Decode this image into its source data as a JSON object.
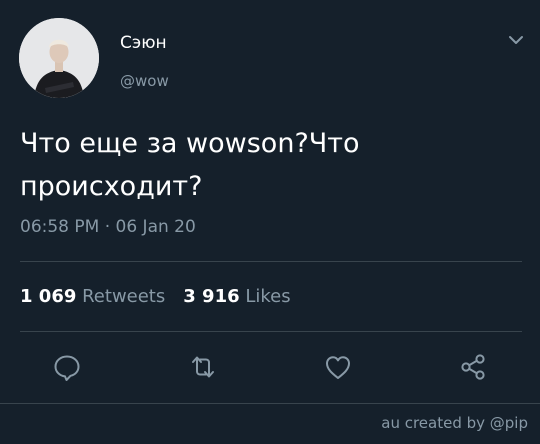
{
  "author": {
    "name": "Сэюн",
    "handle": "@wow"
  },
  "tweet": {
    "text_line1": "Что еще за wowson?Что",
    "text_line2": "происходит?",
    "timestamp": "06:58 PM · 06 Jan 20"
  },
  "stats": {
    "retweets_count": "1 069",
    "retweets_label": "Retweets",
    "likes_count": "3 916",
    "likes_label": "Likes"
  },
  "actions": [
    "reply-icon",
    "retweet-icon",
    "like-icon",
    "share-icon"
  ],
  "footer": {
    "credit": "au created by @pip"
  },
  "colors": {
    "background": "#15202b",
    "text": "#ffffff",
    "secondary": "#8899a6",
    "divider": "#38444d"
  }
}
